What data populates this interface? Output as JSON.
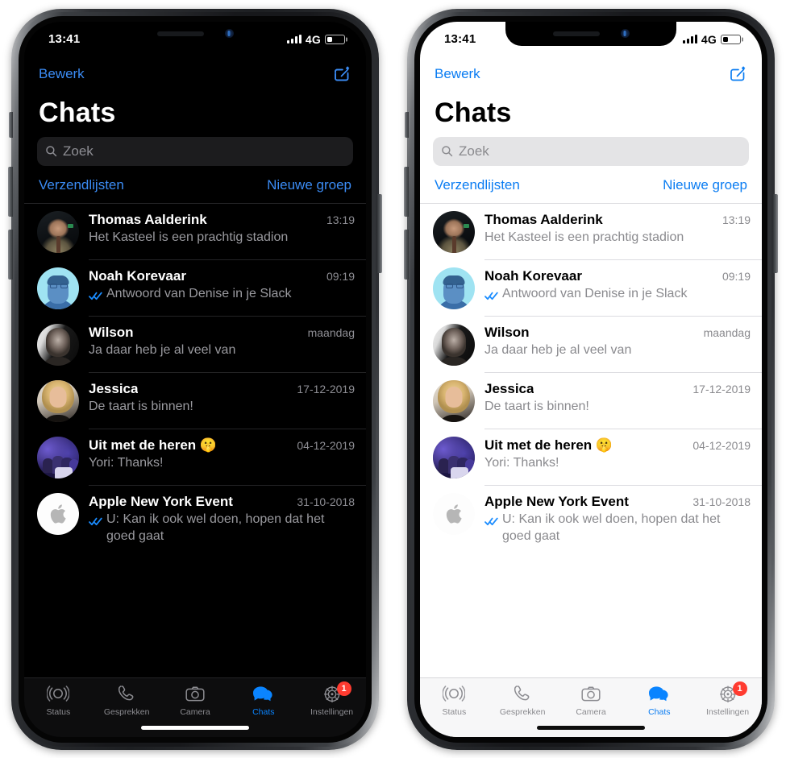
{
  "status_bar": {
    "time": "13:41",
    "network": "4G",
    "battery_level": 30
  },
  "nav": {
    "edit_label": "Bewerk",
    "compose_icon": "compose-icon"
  },
  "header": {
    "title": "Chats"
  },
  "search": {
    "placeholder": "Zoek",
    "icon": "search-icon"
  },
  "list_actions": {
    "broadcast_label": "Verzendlijsten",
    "new_group_label": "Nieuwe groep"
  },
  "chats": [
    {
      "name": "Thomas Aalderink",
      "time": "13:19",
      "preview": "Het Kasteel is een prachtig stadion",
      "read_receipt": false,
      "avatar": "photo-man-dark"
    },
    {
      "name": "Noah Korevaar",
      "time": "09:19",
      "preview": "Antwoord van Denise in je Slack",
      "read_receipt": true,
      "avatar": "photo-man-blue"
    },
    {
      "name": "Wilson",
      "time": "maandag",
      "preview": "Ja daar heb je al veel van",
      "read_receipt": false,
      "avatar": "photo-man-bw"
    },
    {
      "name": "Jessica",
      "time": "17-12-2019",
      "preview": "De taart is binnen!",
      "read_receipt": false,
      "avatar": "photo-woman-blonde"
    },
    {
      "name": "Uit met de heren 🤫",
      "time": "04-12-2019",
      "preview": "Yori: Thanks!",
      "read_receipt": false,
      "avatar": "photo-group-purple"
    },
    {
      "name": "Apple New York Event",
      "time": "31-10-2018",
      "preview": "U: Kan ik ook wel doen, hopen dat het goed gaat",
      "read_receipt": true,
      "avatar": "apple-logo"
    }
  ],
  "tabs": [
    {
      "label": "Status",
      "icon": "status-rings-icon",
      "active": false,
      "badge": ""
    },
    {
      "label": "Gesprekken",
      "icon": "phone-icon",
      "active": false,
      "badge": ""
    },
    {
      "label": "Camera",
      "icon": "camera-icon",
      "active": false,
      "badge": ""
    },
    {
      "label": "Chats",
      "icon": "chat-bubbles-icon",
      "active": true,
      "badge": ""
    },
    {
      "label": "Instellingen",
      "icon": "gear-icon",
      "active": false,
      "badge": "1"
    }
  ],
  "colors": {
    "accent_blue": "#0a84ff",
    "badge_red": "#ff3b30",
    "dark_bg": "#000000",
    "light_bg": "#ffffff"
  }
}
